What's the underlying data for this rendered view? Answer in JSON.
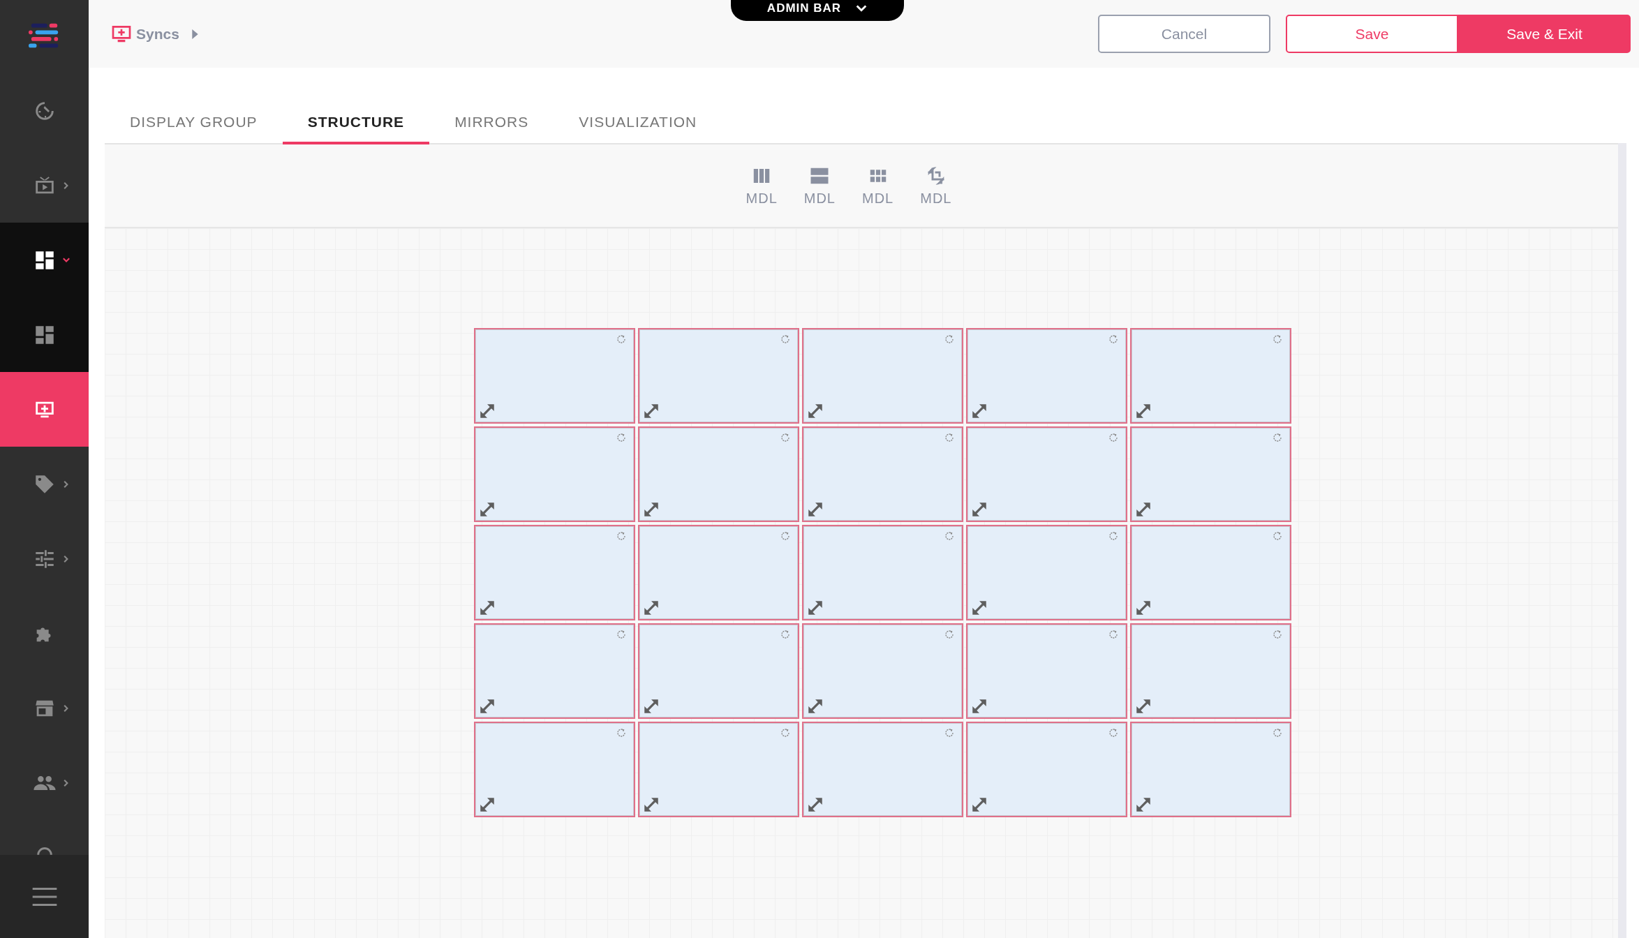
{
  "sidebar": {
    "items": [
      {
        "selected": false,
        "has_submenu": false
      },
      {
        "selected": false,
        "has_submenu": true
      },
      {
        "selected": false,
        "has_submenu": true,
        "expanded": true,
        "children": [
          {
            "selected": false
          }
        ]
      },
      {
        "selected": true,
        "has_submenu": false
      },
      {
        "selected": false,
        "has_submenu": true
      },
      {
        "selected": false,
        "has_submenu": true
      },
      {
        "selected": false,
        "has_submenu": false
      },
      {
        "selected": false,
        "has_submenu": true
      },
      {
        "selected": false,
        "has_submenu": true
      }
    ]
  },
  "admin_bar": {
    "label": "ADMIN BAR"
  },
  "breadcrumb": {
    "label": "Syncs"
  },
  "buttons": {
    "cancel": "Cancel",
    "save": "Save",
    "save_exit": "Save & Exit"
  },
  "tabs": [
    {
      "label": "DISPLAY GROUP",
      "selected": false
    },
    {
      "label": "STRUCTURE",
      "selected": true
    },
    {
      "label": "MIRRORS",
      "selected": false
    },
    {
      "label": "VISUALIZATION",
      "selected": false
    }
  ],
  "toolbar": [
    {
      "label": "MDL"
    },
    {
      "label": "MDL"
    },
    {
      "label": "MDL"
    },
    {
      "label": "MDL"
    }
  ]
}
